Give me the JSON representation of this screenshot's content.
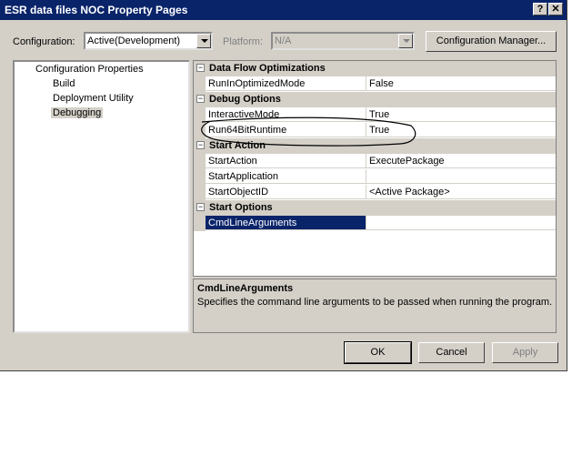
{
  "window": {
    "title": "ESR data files NOC Property Pages",
    "help_button": "?",
    "close_button": "✕"
  },
  "toolbar": {
    "configuration_label": "Configuration:",
    "configuration_value": "Active(Development)",
    "platform_label": "Platform:",
    "platform_value": "N/A",
    "config_manager_button": "Configuration Manager..."
  },
  "tree": {
    "root": "Configuration Properties",
    "items": [
      {
        "label": "Build"
      },
      {
        "label": "Deployment Utility"
      },
      {
        "label": "Debugging"
      }
    ]
  },
  "grid": {
    "categories": [
      {
        "name": "Data Flow Optimizations",
        "rows": [
          {
            "name": "RunInOptimizedMode",
            "value": "False"
          }
        ]
      },
      {
        "name": "Debug Options",
        "rows": [
          {
            "name": "InteractiveMode",
            "value": "True"
          },
          {
            "name": "Run64BitRuntime",
            "value": "True"
          }
        ]
      },
      {
        "name": "Start Action",
        "rows": [
          {
            "name": "StartAction",
            "value": "ExecutePackage"
          },
          {
            "name": "StartApplication",
            "value": ""
          },
          {
            "name": "StartObjectID",
            "value": "<Active Package>"
          }
        ]
      },
      {
        "name": "Start Options",
        "rows": [
          {
            "name": "CmdLineArguments",
            "value": ""
          }
        ]
      }
    ],
    "collapse_glyph": "⊟"
  },
  "description": {
    "title": "CmdLineArguments",
    "text": "Specifies the command line arguments to be passed when running the program."
  },
  "buttons": {
    "ok": "OK",
    "cancel": "Cancel",
    "apply": "Apply"
  },
  "colors": {
    "titlebar": "#0a246a",
    "face": "#d4d0c8",
    "selection": "#0a246a"
  }
}
